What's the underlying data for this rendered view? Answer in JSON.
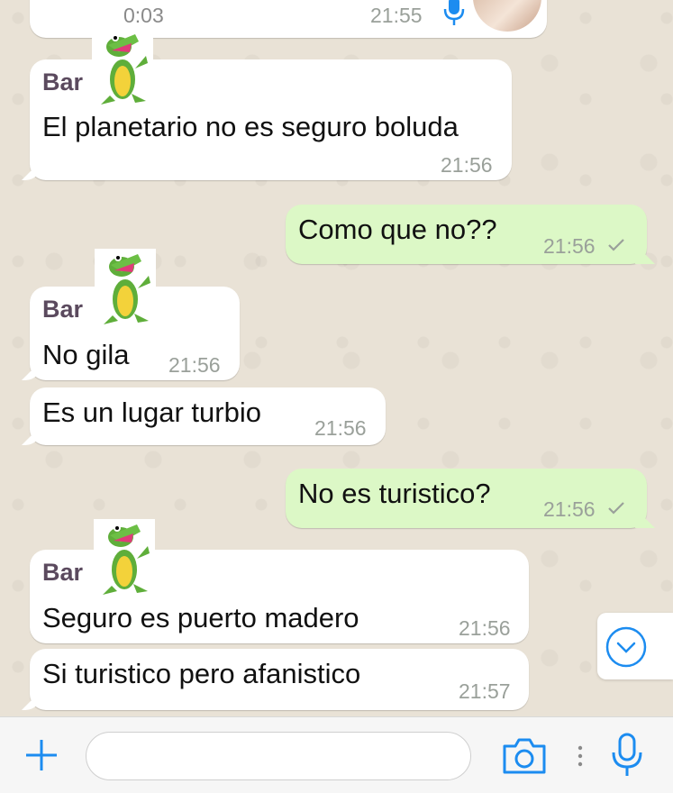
{
  "messages": [
    {
      "id": "voice",
      "duration": "0:03",
      "time": "21:55"
    },
    {
      "id": "m1",
      "direction": "in",
      "sender": "Bar",
      "text": "El planetario no es seguro boluda",
      "time": "21:56"
    },
    {
      "id": "m2",
      "direction": "out",
      "text": "Como que no??",
      "time": "21:56"
    },
    {
      "id": "m3",
      "direction": "in",
      "sender": "Bar",
      "text": "No gila",
      "time": "21:56"
    },
    {
      "id": "m4",
      "direction": "in",
      "text": "Es un lugar turbio",
      "time": "21:56"
    },
    {
      "id": "m5",
      "direction": "out",
      "text": "No es turistico?",
      "time": "21:56"
    },
    {
      "id": "m6",
      "direction": "in",
      "sender": "Bar",
      "text": "Seguro es puerto madero",
      "time": "21:56"
    },
    {
      "id": "m7",
      "direction": "in",
      "text": "Si turistico pero afanistico",
      "time": "21:57"
    }
  ],
  "input_bar": {
    "message_text": "",
    "icons": [
      "plus-icon",
      "camera-icon",
      "more-vertical-icon",
      "microphone-icon"
    ]
  },
  "colors": {
    "incoming_bubble": "#ffffff",
    "outgoing_bubble": "#dcf8c6",
    "accent_blue": "#1c8cf0",
    "sender_name": "#5b4a5e",
    "timestamp": "#9aa09a"
  }
}
